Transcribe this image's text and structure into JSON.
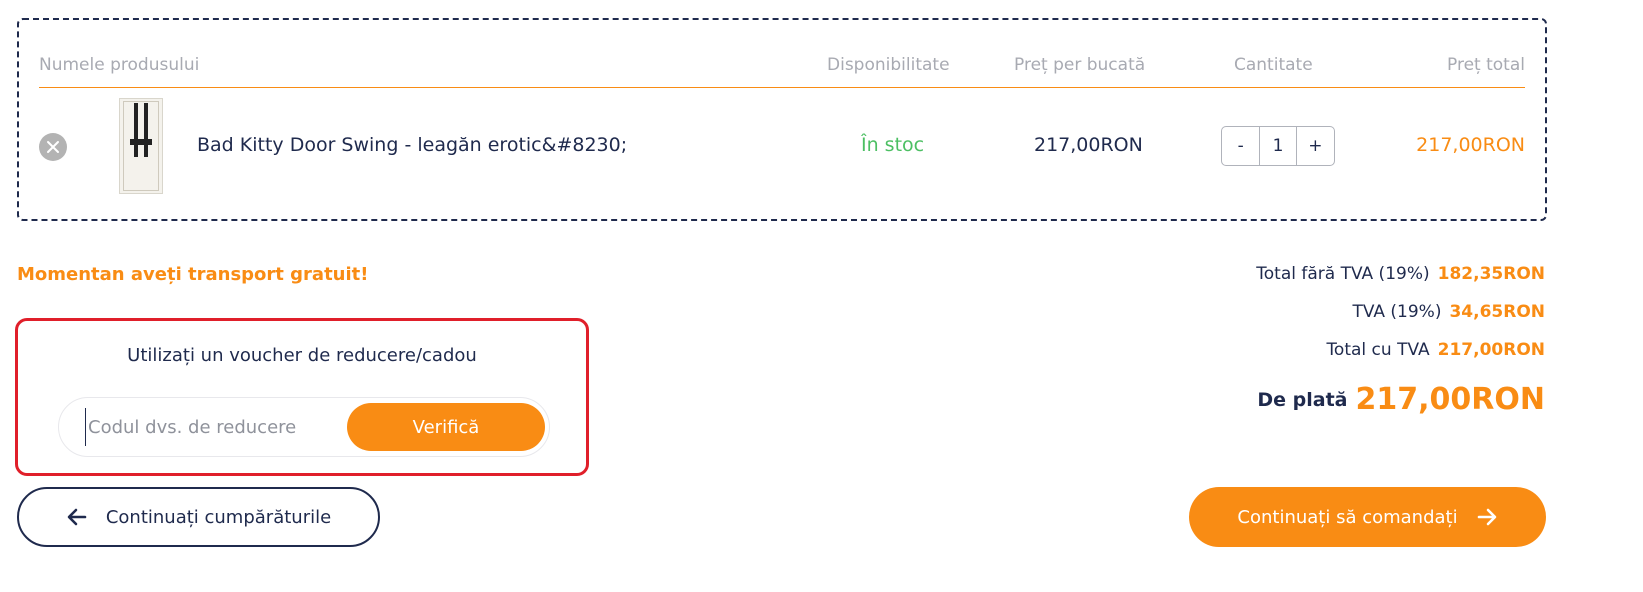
{
  "table": {
    "headers": {
      "name": "Numele produsului",
      "availability": "Disponibilitate",
      "unit_price": "Preț per bucată",
      "quantity": "Cantitate",
      "total": "Preț total"
    },
    "rows": [
      {
        "name": "Bad Kitty Door Swing - leagăn erotic&#8230;",
        "availability": "În stoc",
        "unit_price": "217,00RON",
        "quantity": "1",
        "total": "217,00RON",
        "qty_minus": "-",
        "qty_plus": "+"
      }
    ]
  },
  "shipping": {
    "message": "Momentan aveți transport gratuit!"
  },
  "voucher": {
    "title": "Utilizați un voucher de reducere/cadou",
    "placeholder": "Codul dvs. de reducere",
    "value": "",
    "button_label": "Verifică"
  },
  "totals": {
    "without_vat_label": "Total fără TVA (19%)",
    "without_vat_value": "182,35RON",
    "vat_label": "TVA (19%)",
    "vat_value": "34,65RON",
    "with_vat_label": "Total cu TVA",
    "with_vat_value": "217,00RON",
    "to_pay_label": "De plată",
    "to_pay_value": "217,00RON"
  },
  "actions": {
    "continue_shopping": "Continuați cumpărăturile",
    "continue_order": "Continuați să comandați"
  },
  "colors": {
    "accent": "#f98c14",
    "navy": "#1f2a4d",
    "in_stock": "#4cbf63",
    "voucher_highlight": "#e01f2a"
  },
  "icons": {
    "remove": "close-icon",
    "back": "arrow-left-icon",
    "forward": "arrow-right-icon"
  }
}
